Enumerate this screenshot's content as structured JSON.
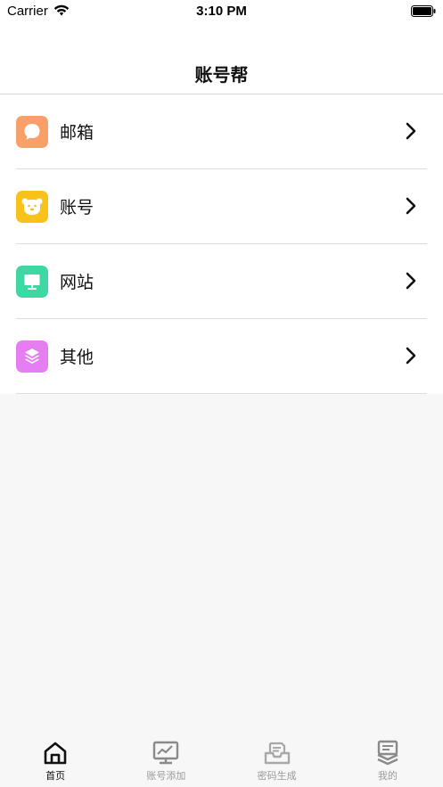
{
  "status_bar": {
    "carrier": "Carrier",
    "time": "3:10 PM"
  },
  "nav": {
    "title": "账号帮"
  },
  "list": {
    "items": [
      {
        "label": "邮箱",
        "icon": "mail-chat-icon",
        "color": "#F9A06A"
      },
      {
        "label": "账号",
        "icon": "bear-face-icon",
        "color": "#F9C21A"
      },
      {
        "label": "网站",
        "icon": "monitor-icon",
        "color": "#3ED9A2"
      },
      {
        "label": "其他",
        "icon": "layers-icon",
        "color": "#E57EF0"
      }
    ]
  },
  "tab_bar": {
    "tabs": [
      {
        "label": "首页",
        "icon": "home-icon",
        "active": true
      },
      {
        "label": "账号添加",
        "icon": "chart-monitor-icon",
        "active": false
      },
      {
        "label": "密码生成",
        "icon": "inbox-icon",
        "active": false
      },
      {
        "label": "我的",
        "icon": "profile-icon",
        "active": false
      }
    ]
  },
  "colors": {
    "active_tab": "#111111",
    "inactive_tab": "#9a9a9a",
    "background": "#f7f7f7"
  }
}
